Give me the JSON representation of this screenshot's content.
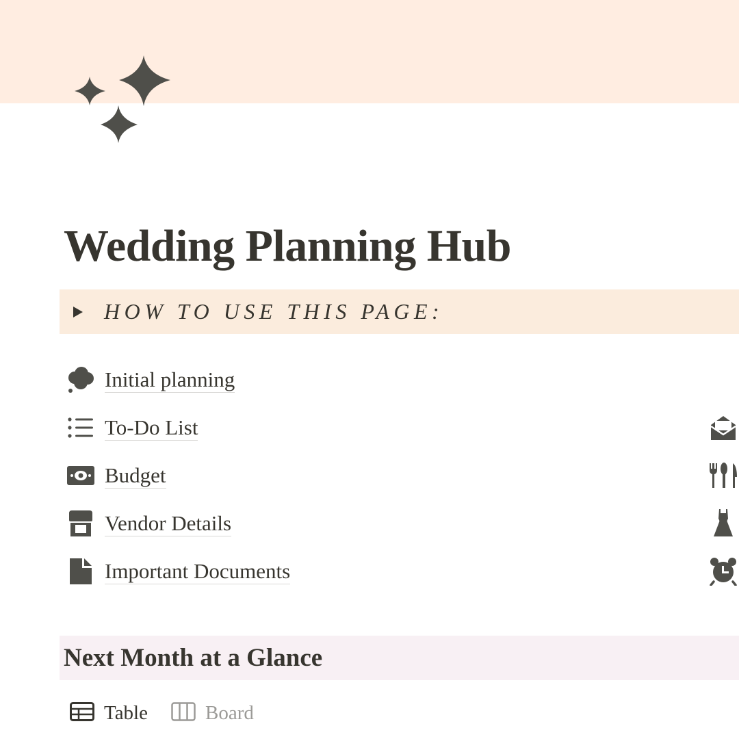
{
  "page": {
    "title": "Wedding Planning Hub",
    "icon": "sparkles-icon"
  },
  "callout": {
    "text": "HOW TO USE THIS PAGE:",
    "icon": "toggle-triangle-icon"
  },
  "links": [
    {
      "label": "Initial planning",
      "icon": "thought-bubble-icon"
    },
    {
      "label": "To-Do List",
      "icon": "bulleted-list-icon"
    },
    {
      "label": "Budget",
      "icon": "money-bill-icon"
    },
    {
      "label": "Vendor Details",
      "icon": "storefront-icon"
    },
    {
      "label": "Important Documents",
      "icon": "document-icon"
    }
  ],
  "right_icons": [
    "open-envelope-icon",
    "cutlery-icon",
    "dress-icon",
    "alarm-clock-icon"
  ],
  "section": {
    "heading": "Next Month at a Glance"
  },
  "views": [
    {
      "label": "Table",
      "icon": "table-icon",
      "active": true
    },
    {
      "label": "Board",
      "icon": "board-icon",
      "active": false
    }
  ],
  "colors": {
    "cover": "#ffede1",
    "callout_bg": "#fbecdd",
    "section_bg": "#f8f0f4",
    "text": "#37352f",
    "muted": "#9b9a97",
    "icon": "#4f4f4a"
  }
}
